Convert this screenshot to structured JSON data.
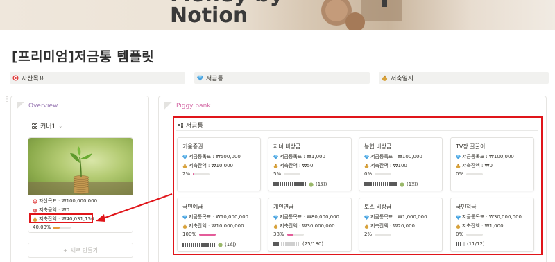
{
  "cover": {
    "title": "Money by\nNotion"
  },
  "page": {
    "title": "[프리미엄]저금통 템플릿"
  },
  "links": [
    {
      "label": "자산목표",
      "icon": "target-icon"
    },
    {
      "label": "저금통",
      "icon": "gem-icon"
    },
    {
      "label": "저축일지",
      "icon": "money-bag-icon"
    }
  ],
  "overview": {
    "title": "Overview",
    "view_label": "커버1",
    "card": {
      "goal": "자산목표 : ₩100,000,000",
      "amount": "저축금액 : ₩0",
      "balance": "저축잔액 : ₩40,031,150",
      "progress_text": "40.03%",
      "progress": 0.4003
    },
    "new_label": "새로 만들기"
  },
  "piggy": {
    "title": "Piggy bank",
    "view_label": "저금통",
    "cards": [
      {
        "name": "키움증권",
        "goal": "저금통목표 : ₩500,000",
        "balance": "저축잔액 : ₩10,000",
        "pct": "2%",
        "progress": 0.02,
        "count": ""
      },
      {
        "name": "자녀 비상금",
        "goal": "저금통목표 : ₩1,000",
        "balance": "저축잔액 : ₩50",
        "pct": "5%",
        "progress": 0.05,
        "count": "(1회)"
      },
      {
        "name": "농협 비상금",
        "goal": "저금통목표 : ₩100,000",
        "balance": "저축잔액 : ₩100",
        "pct": "0%",
        "progress": 0.0,
        "count": "(1회)"
      },
      {
        "name": "TV장 꿀꿀이",
        "goal": "저금통목표 : ₩100,000",
        "balance": "저축잔액 : ₩0",
        "pct": "0%",
        "progress": 0.0,
        "count": ""
      },
      {
        "name": "국민예금",
        "goal": "저금통목표 : ₩10,000,000",
        "balance": "저축잔액 : ₩10,000,000",
        "pct": "100%",
        "progress": 1.0,
        "count": "(1회)"
      },
      {
        "name": "개인연금",
        "goal": "저금통목표 : ₩80,000,000",
        "balance": "저축잔액 : ₩30,000,000",
        "pct": "38%",
        "progress": 0.38,
        "count": "(25/180)"
      },
      {
        "name": "토스 비상금",
        "goal": "저금통목표 : ₩1,000,000",
        "balance": "저축잔액 : ₩20,000",
        "pct": "2%",
        "progress": 0.02,
        "count": ""
      },
      {
        "name": "국민적금",
        "goal": "저금통목표 : ₩30,000,000",
        "balance": "저축잔액 : ₩1,000",
        "pct": "0%",
        "progress": 0.0,
        "count": "(11/12)"
      }
    ]
  },
  "colors": {
    "accent_red": "#e0151a",
    "progress_pink": "#e45c9a",
    "progress_orange": "#e59a3a",
    "heading_purple": "#9b7bb5"
  }
}
